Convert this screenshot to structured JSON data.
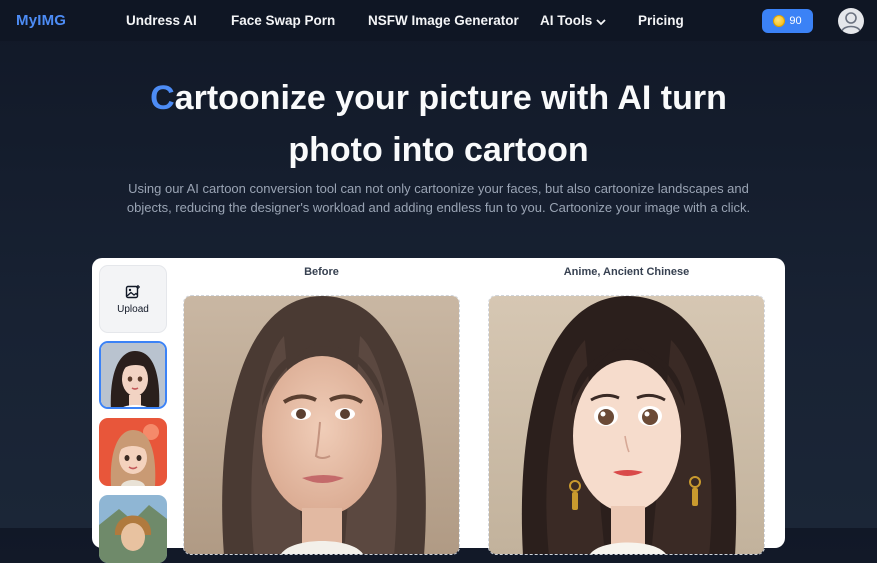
{
  "nav": {
    "logo": "MyIMG",
    "links": [
      "Undress AI",
      "Face Swap Porn",
      "NSFW Image Generator",
      "AI Tools",
      "Pricing"
    ],
    "credits": "90",
    "accent": "#3b82f6"
  },
  "hero": {
    "title_first": "C",
    "title_rest": "artoonize your picture with AI turn",
    "title_line2": "photo into cartoon",
    "subtitle": "Using our AI cartoon conversion tool can not only cartoonize your faces, but also cartoonize landscapes and objects, reducing the designer's workload and adding endless fun to you. Cartoonize your image with a click."
  },
  "editor": {
    "upload_label": "Upload",
    "before_label": "Before",
    "after_label": "Anime, Ancient Chinese"
  }
}
